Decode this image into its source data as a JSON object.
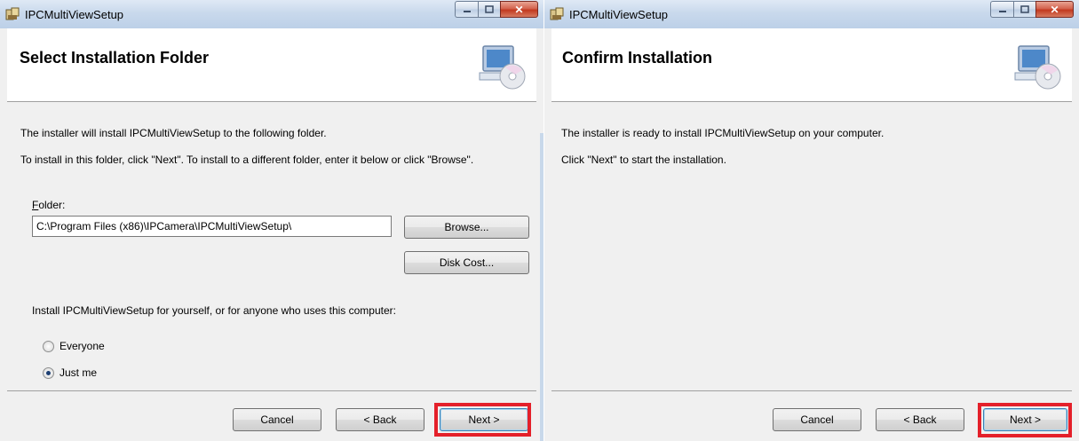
{
  "windows": {
    "left": {
      "title": "IPCMultiViewSetup",
      "banner_title": "Select Installation Folder",
      "line1": "The installer will install IPCMultiViewSetup to the following folder.",
      "line2": "To install in this folder, click \"Next\". To install to a different folder, enter it below or click \"Browse\".",
      "folder_label_u": "F",
      "folder_label_rest": "older:",
      "folder_value": "C:\\Program Files (x86)\\IPCamera\\IPCMultiViewSetup\\",
      "browse_label": "Browse...",
      "disk_cost_label": "Disk Cost...",
      "install_for_text": "Install IPCMultiViewSetup for yourself, or for anyone who uses this computer:",
      "radio_options": [
        "Everyone",
        "Just me"
      ],
      "selected_option": "Just me",
      "cancel_label": "Cancel",
      "back_label": "< Back",
      "next_label": "Next >"
    },
    "right": {
      "title": "IPCMultiViewSetup",
      "banner_title": "Confirm Installation",
      "line1": "The installer is ready to install IPCMultiViewSetup on your computer.",
      "line2": "Click \"Next\" to start the installation.",
      "cancel_label": "Cancel",
      "back_label": "< Back",
      "next_label": "Next >"
    }
  },
  "icons": {
    "app": "installer-icon",
    "banner": "computer-cd-icon",
    "minimize": "minimize-icon",
    "maximize": "maximize-icon",
    "close": "close-icon"
  },
  "colors": {
    "highlight": "#e4202a",
    "titlebar": "#c9d9ec",
    "close_button": "#c2391f"
  }
}
